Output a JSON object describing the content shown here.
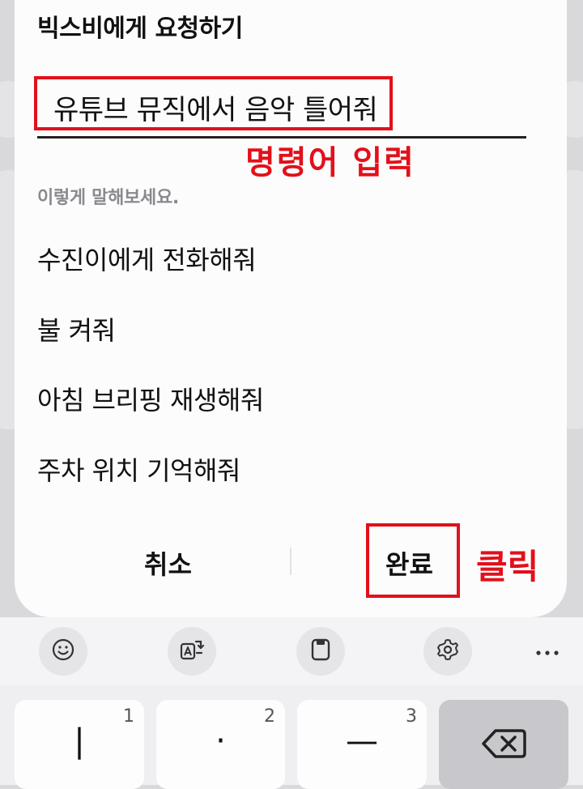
{
  "dialog": {
    "title": "빅스비에게 요청하기",
    "input_value": "유튜브 뮤직에서 음악 틀어줘",
    "hint": "이렇게 말해보세요.",
    "suggestions": [
      "수진이에게 전화해줘",
      "불 켜줘",
      "아침 브리핑 재생해줘",
      "주차 위치 기억해줘"
    ],
    "cancel_label": "취소",
    "done_label": "완료"
  },
  "annotations": {
    "input_label": "명령어 입력",
    "click_label": "클릭",
    "color": "#e2101a"
  },
  "toolbar": {
    "icons": [
      "emoji-icon",
      "translate-icon",
      "clipboard-icon",
      "settings-icon",
      "more-icon"
    ]
  },
  "keyboard": {
    "keys": [
      {
        "glyph": "|",
        "num": "1"
      },
      {
        "glyph": "·",
        "num": "2"
      },
      {
        "glyph": "—",
        "num": "3"
      }
    ],
    "delete_icon": "backspace-icon"
  }
}
